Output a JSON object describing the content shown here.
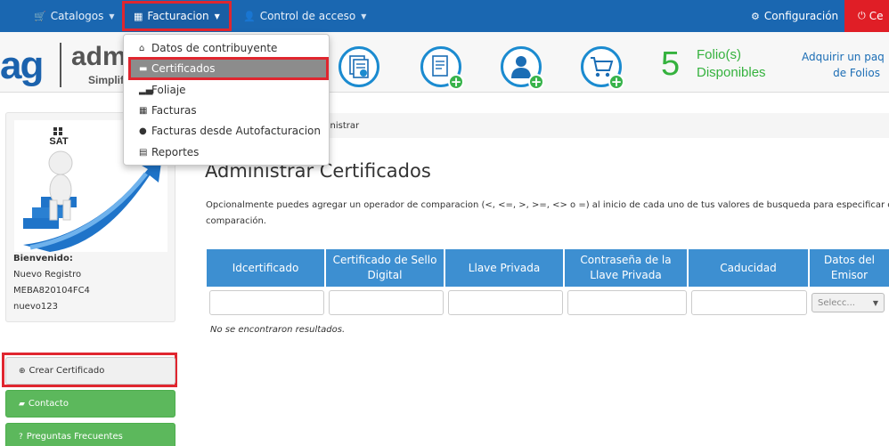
{
  "navbar": {
    "catalogos": "Catalogos",
    "facturacion": "Facturacion",
    "control_acceso": "Control de acceso",
    "configuracion": "Configuración",
    "cerrar": "Ce"
  },
  "header": {
    "logo_ag": "ag",
    "logo_adm": "adm",
    "logo_sub": "Simplif",
    "folio_count": "5",
    "folio_label_1": "Folio(s)",
    "folio_label_2": "Disponibles",
    "adquirir_1": "Adquirir un paq",
    "adquirir_2": "de Folios"
  },
  "dropdown": {
    "items": [
      {
        "label": "Datos de contribuyente",
        "icon": "home-icon"
      },
      {
        "label": "Certificados",
        "icon": "lock-icon"
      },
      {
        "label": "Foliaje",
        "icon": "signal-icon"
      },
      {
        "label": "Facturas",
        "icon": "qrcode-icon"
      },
      {
        "label": "Facturas desde Autofacturacion",
        "icon": "globe-icon"
      },
      {
        "label": "Reportes",
        "icon": "print-icon"
      }
    ]
  },
  "sidebar": {
    "logo_text": "SAT",
    "welcome": "Bienvenido:",
    "name": "Nuevo Registro",
    "rfc": "MEBA820104FC4",
    "user": "nuevo123",
    "buttons": {
      "crear": "Crear Certificado",
      "contacto": "Contacto",
      "preguntas": "Preguntas Frecuentes"
    }
  },
  "main": {
    "breadcrumb": "ministrar",
    "title": "Administrar Certificados",
    "description_line1": "Opcionalmente puedes agregar un operador de comparacion (<, <=, >, >=, <> o =) al inicio de cada uno de tus valores de busqueda para especificar como sera",
    "description_line2": "comparación.",
    "table": {
      "headers": [
        {
          "label": "Idcertificado"
        },
        {
          "label": "Certificado de Sello Digital"
        },
        {
          "label": "Llave Privada"
        },
        {
          "label": "Contraseña de la Llave Privada"
        },
        {
          "label": "Caducidad"
        },
        {
          "label": "Datos del Emisor"
        }
      ],
      "select_placeholder": "Selecc...",
      "empty_message": "No se encontraron resultados."
    }
  }
}
